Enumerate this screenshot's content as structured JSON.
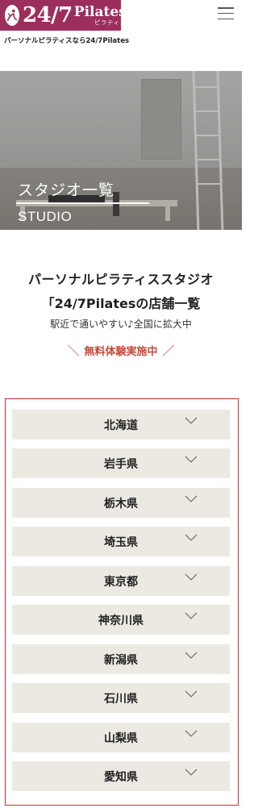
{
  "header": {
    "logo_number": "24/7",
    "logo_word": "Pilates",
    "logo_kana": "ピラティス",
    "tagline": "パーソナルピラティスなら24/7Pilates",
    "menu_icon": "hamburger-icon"
  },
  "hero": {
    "title": "スタジオ一覧",
    "subtitle": "STUDIO"
  },
  "intro": {
    "line1": "パーソナルピラティススタジオ",
    "line2": "「24/7Pilatesの店舗一覧",
    "line3": "駅近で通いやすい♪全国に拡大中"
  },
  "campaign": {
    "slash_left": "＼",
    "text": "無料体験実施中",
    "slash_right": "／"
  },
  "prefectures": [
    {
      "label": "北海道"
    },
    {
      "label": "岩手県"
    },
    {
      "label": "栃木県"
    },
    {
      "label": "埼玉県"
    },
    {
      "label": "東京都"
    },
    {
      "label": "神奈川県"
    },
    {
      "label": "新潟県"
    },
    {
      "label": "石川県"
    },
    {
      "label": "山梨県"
    },
    {
      "label": "愛知県"
    }
  ],
  "colors": {
    "brand": "#9c2e5c",
    "accent": "#c6493a",
    "border": "#cf2c2c",
    "item_bg": "#ece9e3"
  }
}
